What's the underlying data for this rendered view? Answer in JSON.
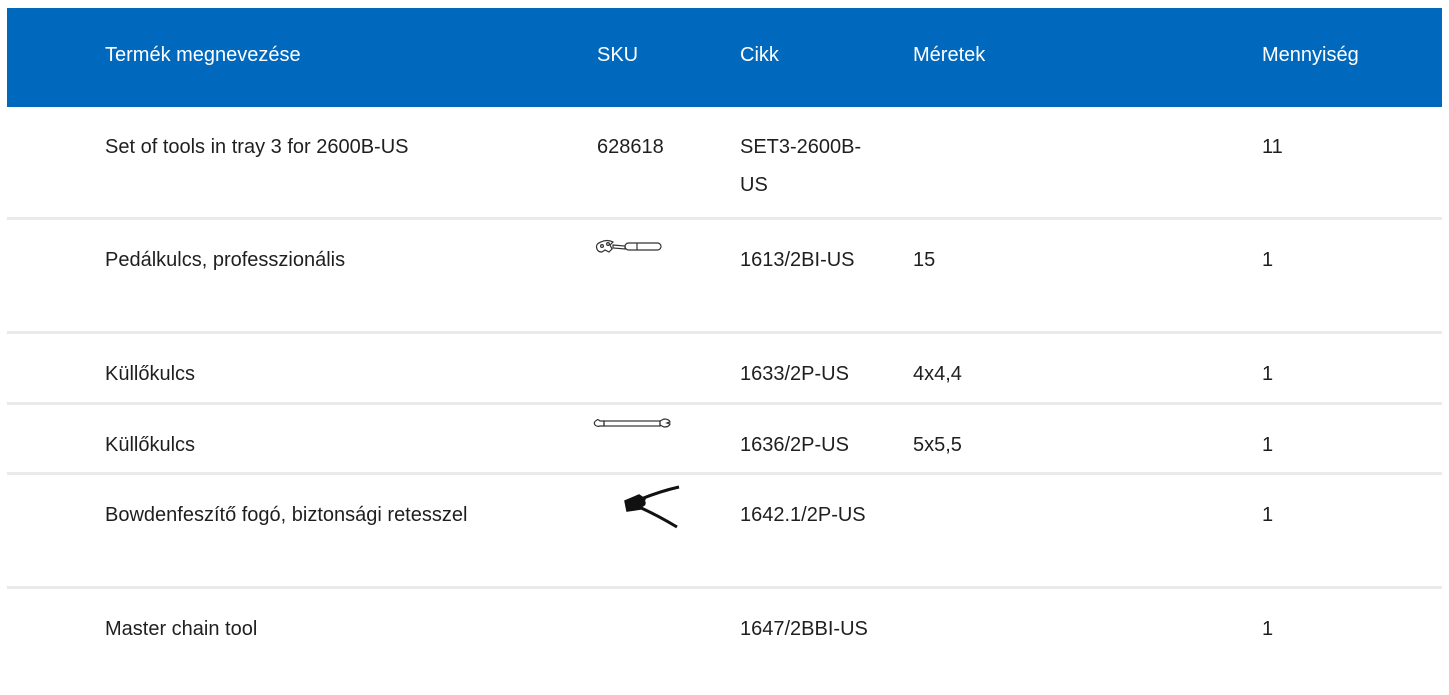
{
  "header": {
    "name": "Termék megnevezése",
    "sku": "SKU",
    "cikk": "Cikk",
    "dim": "Méretek",
    "qty": "Mennyiség"
  },
  "colors": {
    "header_bg": "#0068bd",
    "header_text": "#ffffff",
    "row_divider": "#eaeaea"
  },
  "rows": [
    {
      "name": "Set of tools in tray 3 for 2600B-US",
      "sku": "628618",
      "cikk": "SET3-2600B-US",
      "dim": "",
      "qty": "11",
      "icon": ""
    },
    {
      "name": "Pedálkulcs, professzionális",
      "sku": "",
      "cikk": "1613/2BI-US",
      "dim": "15",
      "qty": "1",
      "icon": "pedal-wrench-icon"
    },
    {
      "name": "Küllőkulcs",
      "sku": "",
      "cikk": "1633/2P-US",
      "dim": "4x4,4",
      "qty": "1",
      "icon": ""
    },
    {
      "name": "Küllőkulcs",
      "sku": "",
      "cikk": "1636/2P-US",
      "dim": "5x5,5",
      "qty": "1",
      "icon": "spoke-wrench-icon"
    },
    {
      "name": "Bowdenfeszítő fogó, biztonsági retesszel",
      "sku": "",
      "cikk": "1642.1/2P-US",
      "dim": "",
      "qty": "1",
      "icon": "cable-pliers-icon"
    },
    {
      "name": "Master chain tool",
      "sku": "",
      "cikk": "1647/2BBI-US",
      "dim": "",
      "qty": "1",
      "icon": ""
    }
  ]
}
